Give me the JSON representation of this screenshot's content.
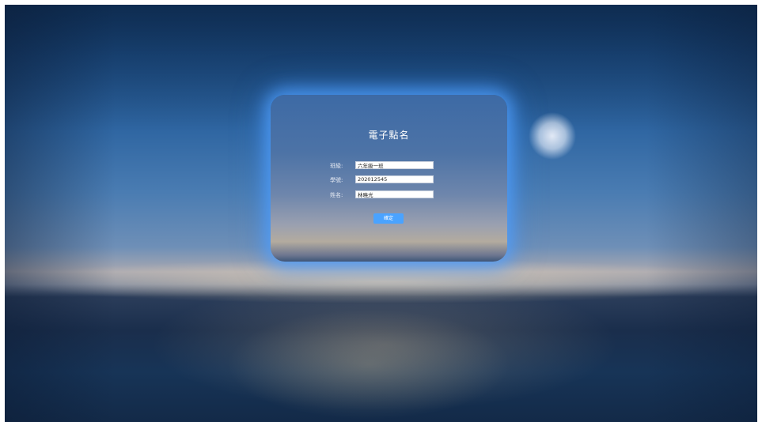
{
  "page": {
    "title": "電子點名"
  },
  "form": {
    "class_label": "班級:",
    "class_value": "六年級一班",
    "student_id_label": "學號:",
    "student_id_value": "202012545",
    "name_label": "姓名:",
    "name_value": "林曉光",
    "submit_label": "確定"
  },
  "colors": {
    "accent": "#4aa3ff",
    "card_glow": "#50a0ff"
  }
}
